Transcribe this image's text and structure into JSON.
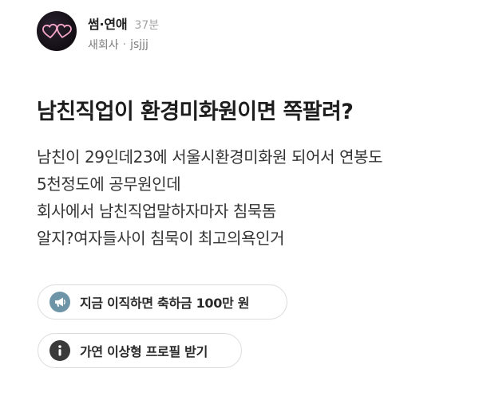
{
  "post": {
    "author": "썸·연애",
    "time": "37분",
    "company": "새회사",
    "separator": "·",
    "handle": "jsjjj",
    "title": "남친직업이 환경미화원이면 쪽팔려?",
    "body_lines": [
      "남친이 29인데23에 서울시환경미화원 되어서 연봉도",
      "5천정도에 공무원인데",
      "회사에서 남친직업말하자마자 침묵돔",
      "알지?여자들사이 침묵이 최고의욕인거"
    ]
  },
  "actions": [
    {
      "icon": "megaphone-icon",
      "label": "지금 이직하면 축하금 100만 원"
    },
    {
      "icon": "info-icon",
      "label": "가연 이상형 프로필 받기"
    }
  ],
  "colors": {
    "megaphone_bg": "#6e94a8",
    "info_bg": "#3a3a3a",
    "heart_outline": "#f4a6c6"
  }
}
